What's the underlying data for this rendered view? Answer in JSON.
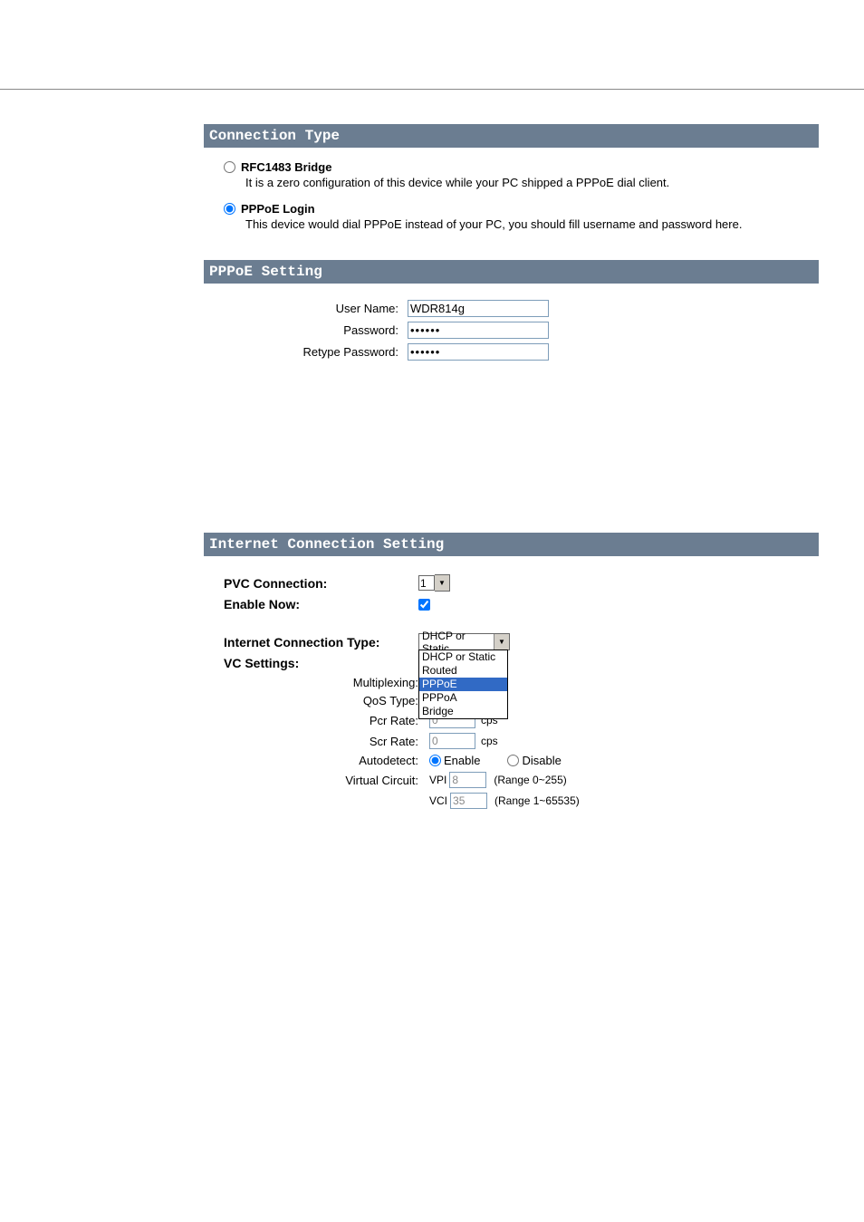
{
  "section1_title": "Connection Type",
  "option1": {
    "label": "RFC1483 Bridge",
    "desc": "It is a zero configuration of this device while your PC shipped a PPPoE dial client."
  },
  "option2": {
    "label": "PPPoE Login",
    "desc": "This device would dial PPPoE instead of your PC, you should fill username and password here."
  },
  "section2_title": "PPPoE Setting",
  "form": {
    "username_label": "User Name:",
    "username_value": "WDR814g",
    "password_label": "Password:",
    "password_value": "••••••",
    "retype_label": "Retype Password:",
    "retype_value": "••••••"
  },
  "quoted": "\"                         \"",
  "section3_title": "Internet Connection Setting",
  "ics": {
    "pvc_label": "PVC Connection:",
    "pvc_value": "1",
    "enable_label": "Enable Now:",
    "enable_checked": true,
    "ict_label": "Internet Connection Type:",
    "ict_selected": "DHCP or Static",
    "ict_options": [
      "DHCP or Static",
      "Routed",
      "PPPoE",
      "PPPoA",
      "Bridge"
    ],
    "vc_label": "VC Settings:",
    "multiplexing_label": "Multiplexing:",
    "qos_label": "QoS Type:",
    "pcr_label": "Pcr Rate:",
    "pcr_value": "0",
    "pcr_unit": "cps",
    "scr_label": "Scr Rate:",
    "scr_value": "0",
    "scr_unit": "cps",
    "autodetect_label": "Autodetect:",
    "enable_opt": "Enable",
    "disable_opt": "Disable",
    "vc_row_label": "Virtual Circuit:",
    "vpi_label": "VPI",
    "vpi_value": "8",
    "vpi_range": "(Range 0~255)",
    "vci_label": "VCI",
    "vci_value": "35",
    "vci_range": "(Range 1~65535)"
  }
}
